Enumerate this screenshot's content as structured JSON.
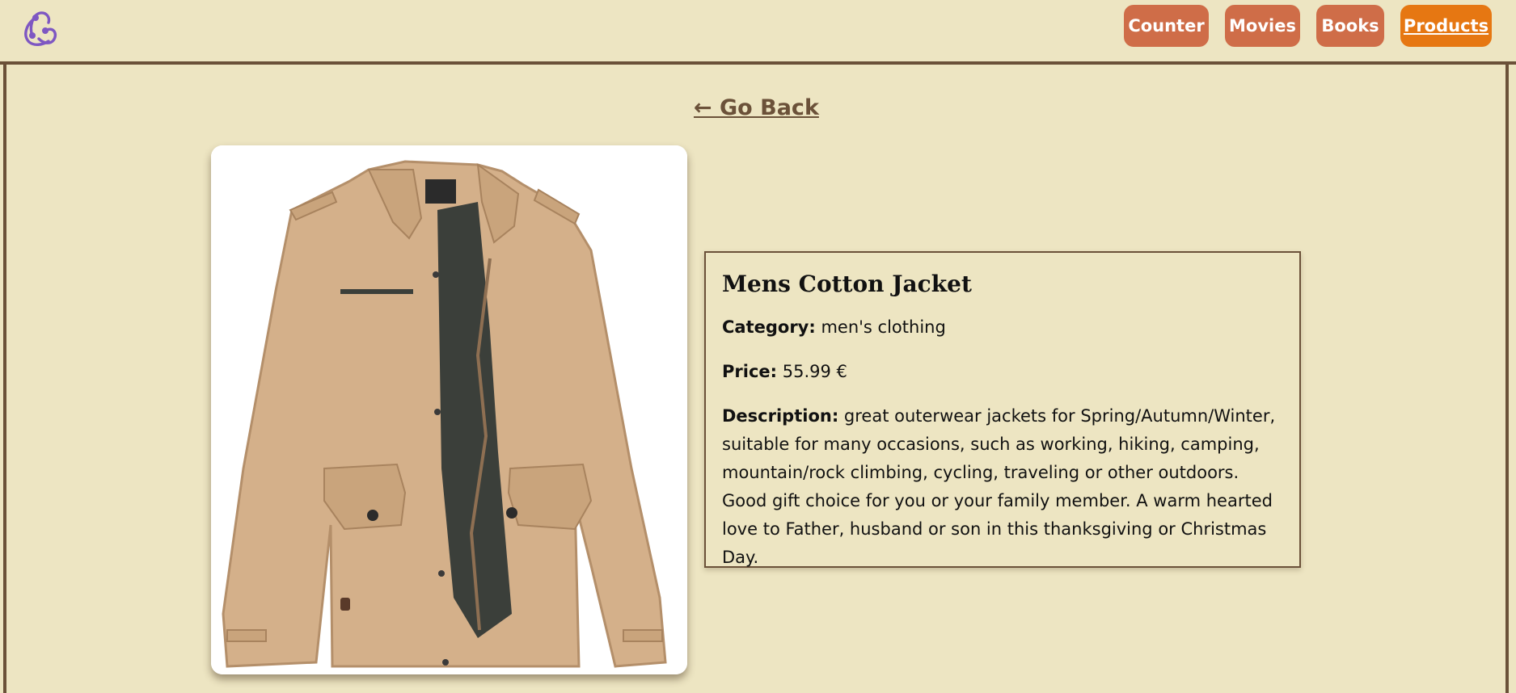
{
  "nav": {
    "counter": "Counter",
    "movies": "Movies",
    "books": "Books",
    "products": "Products",
    "active": "Products"
  },
  "logo": {
    "icon": "redux-logo-icon",
    "color": "#7e57c2"
  },
  "go_back": "← Go Back",
  "product": {
    "image_icon": "jacket-image",
    "title": "Mens Cotton Jacket",
    "category_label": "Category:",
    "category": "men's clothing",
    "price_label": "Price:",
    "price": "55.99 €",
    "description_label": "Description:",
    "description": "great outerwear jackets for Spring/Autumn/Winter, suitable for many occasions, such as working, hiking, camping, mountain/rock climbing, cycling, traveling or other outdoors. Good gift choice for you or your family member. A warm hearted love to Father, husband or son in this thanksgiving or Christmas Day."
  },
  "colors": {
    "background": "#ede5c2",
    "border": "#6b5139",
    "nav_button": "#cf6d48",
    "nav_button_active": "#e67712"
  }
}
